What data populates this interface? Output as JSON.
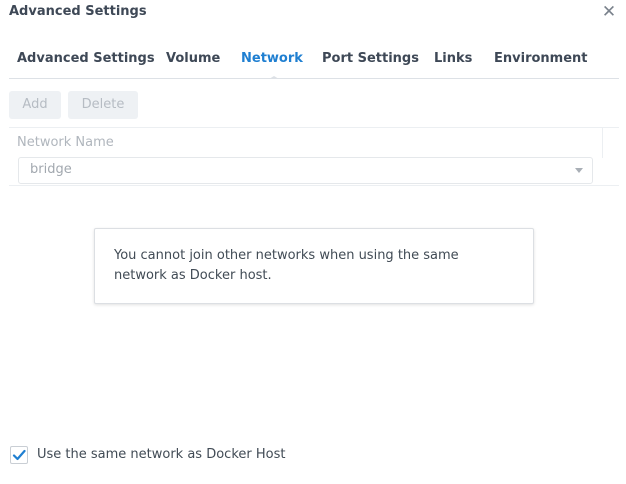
{
  "window": {
    "title": "Advanced Settings",
    "close_icon": "close-icon"
  },
  "tabs": [
    {
      "label": "Advanced Settings",
      "active": false
    },
    {
      "label": "Volume",
      "active": false
    },
    {
      "label": "Network",
      "active": true
    },
    {
      "label": "Port Settings",
      "active": false
    },
    {
      "label": "Links",
      "active": false
    },
    {
      "label": "Environment",
      "active": false
    }
  ],
  "toolbar": {
    "add_label": "Add",
    "delete_label": "Delete",
    "buttons_disabled": true
  },
  "grid": {
    "column_header": "Network Name",
    "rows": [
      {
        "network": "bridge"
      }
    ]
  },
  "notice": {
    "message": "You cannot join other networks when using the same network as Docker host."
  },
  "options": {
    "same_network_label": "Use the same network as Docker Host",
    "same_network_checked": true
  },
  "colors": {
    "accent": "#1f7fd1",
    "text": "#414b55",
    "disabled_text": "#b6bcc3"
  }
}
